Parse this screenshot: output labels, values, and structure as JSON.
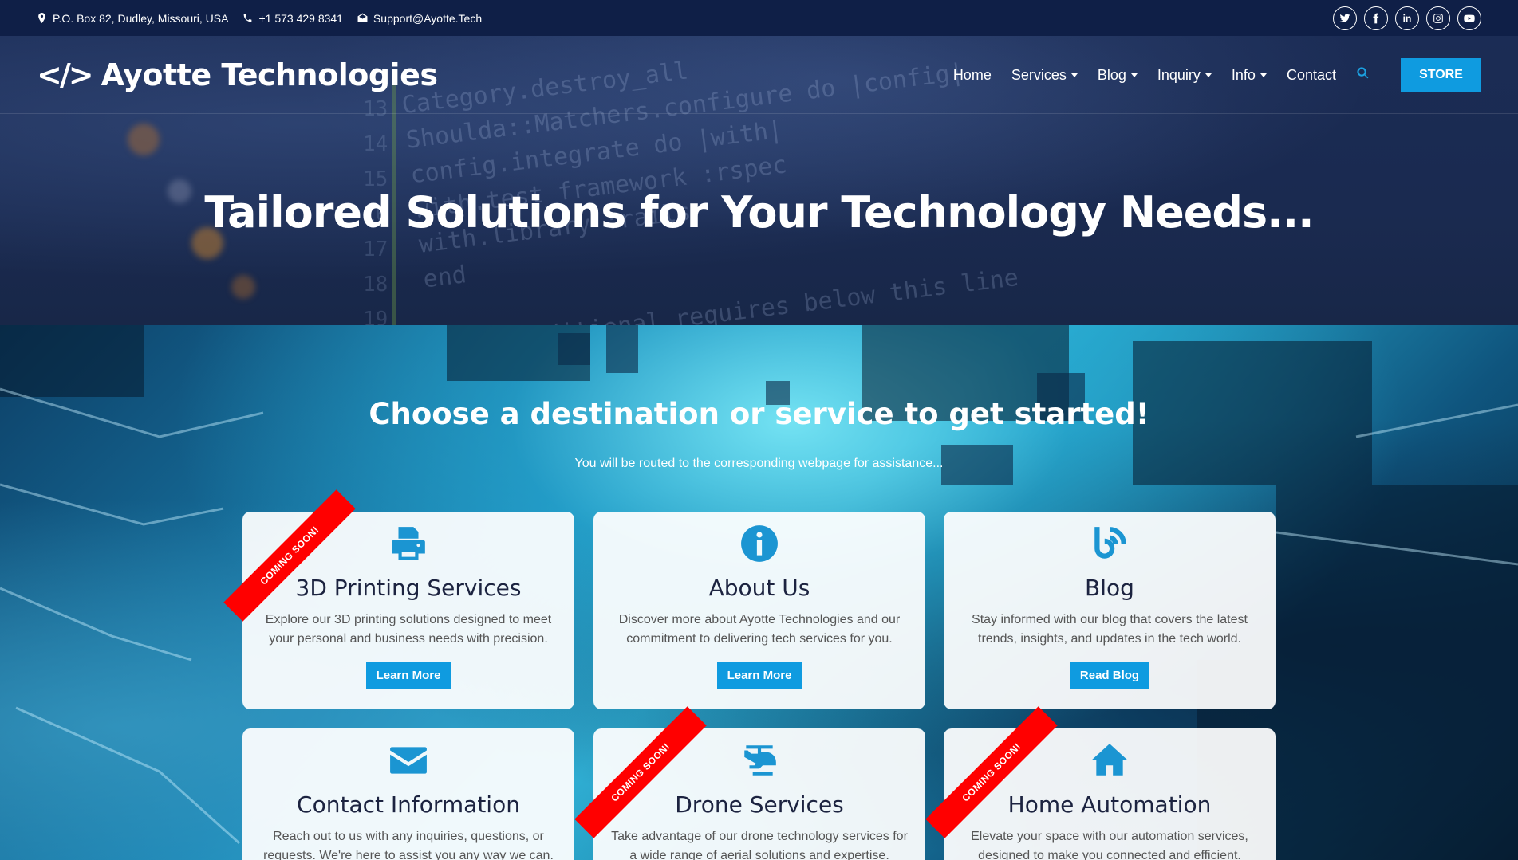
{
  "topbar": {
    "address": "P.O. Box 82, Dudley, Missouri, USA",
    "phone": "+1 573 429 8341",
    "email": "Support@Ayotte.Tech",
    "socials": [
      "twitter-icon",
      "facebook-icon",
      "linkedin-icon",
      "instagram-icon",
      "youtube-icon"
    ]
  },
  "nav": {
    "logo_mark": "</>",
    "logo_text": "Ayotte Technologies",
    "items": [
      {
        "label": "Home",
        "dropdown": false
      },
      {
        "label": "Services",
        "dropdown": true
      },
      {
        "label": "Blog",
        "dropdown": true
      },
      {
        "label": "Inquiry",
        "dropdown": true
      },
      {
        "label": "Info",
        "dropdown": true
      },
      {
        "label": "Contact",
        "dropdown": false
      }
    ],
    "store_label": "STORE"
  },
  "hero": {
    "title": "Tailored Solutions for Your Technology Needs...",
    "code_lines": [
      "Category.destroy_all",
      "Shoulda::Matchers.configure do |config|",
      "config.integrate do |with|",
      "with.test_framework :rspec",
      "with.library :rails",
      "end",
      "",
      "# Add additional requires below this line"
    ]
  },
  "main": {
    "title": "Choose a destination or service to get started!",
    "subtitle": "You will be routed to the corresponding webpage for assistance...",
    "ribbon_text": "COMING SOON!",
    "cards": [
      {
        "title": "3D Printing Services",
        "text": "Explore our 3D printing solutions designed to meet your personal and business needs with precision.",
        "button": "Learn More",
        "icon": "printer-icon",
        "coming_soon": true
      },
      {
        "title": "About Us",
        "text": "Discover more about Ayotte Technologies and our commitment to delivering tech services for you.",
        "button": "Learn More",
        "icon": "info-icon",
        "coming_soon": false
      },
      {
        "title": "Blog",
        "text": "Stay informed with our blog that covers the latest trends, insights, and updates in the tech world.",
        "button": "Read Blog",
        "icon": "blog-icon",
        "coming_soon": false
      },
      {
        "title": "Contact Information",
        "text": "Reach out to us with any inquiries, questions, or requests. We're here to assist you any way we can.",
        "button": "",
        "icon": "envelope-icon",
        "coming_soon": false
      },
      {
        "title": "Drone Services",
        "text": "Take advantage of our drone technology services for a wide range of aerial solutions and expertise.",
        "button": "",
        "icon": "helicopter-icon",
        "coming_soon": true
      },
      {
        "title": "Home Automation",
        "text": "Elevate your space with our automation services, designed to make you connected and efficient.",
        "button": "",
        "icon": "home-icon",
        "coming_soon": true
      }
    ]
  },
  "colors": {
    "accent": "#0f9be0",
    "ribbon": "#ff0000",
    "topbar": "#0f1f47"
  }
}
